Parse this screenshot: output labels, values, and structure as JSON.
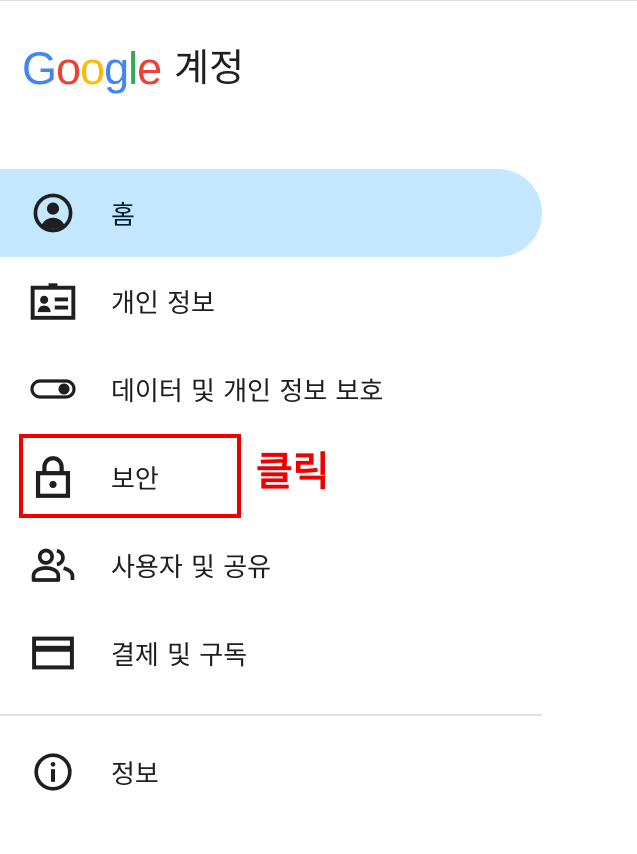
{
  "header": {
    "logo_letters": [
      {
        "char": "G",
        "color": "#4285F4"
      },
      {
        "char": "o",
        "color": "#EA4335"
      },
      {
        "char": "o",
        "color": "#FBBC05"
      },
      {
        "char": "g",
        "color": "#4285F4"
      },
      {
        "char": "l",
        "color": "#34A853"
      },
      {
        "char": "e",
        "color": "#EA4335"
      }
    ],
    "product_name": "계정"
  },
  "nav": {
    "items": [
      {
        "label": "홈",
        "icon": "account-circle-icon",
        "active": true
      },
      {
        "label": "개인 정보",
        "icon": "id-card-icon",
        "active": false
      },
      {
        "label": "데이터 및 개인 정보 보호",
        "icon": "toggle-icon",
        "active": false
      },
      {
        "label": "보안",
        "icon": "lock-icon",
        "active": false
      },
      {
        "label": "사용자 및 공유",
        "icon": "people-icon",
        "active": false
      },
      {
        "label": "결제 및 구독",
        "icon": "credit-card-icon",
        "active": false
      }
    ],
    "info_item": {
      "label": "정보",
      "icon": "info-icon"
    }
  },
  "annotation": {
    "text": "클릭",
    "color": "#EE0000"
  },
  "colors": {
    "active_bg": "#C2E7FF",
    "icon": "#1F1F1F",
    "annotation": "#EE0000"
  }
}
